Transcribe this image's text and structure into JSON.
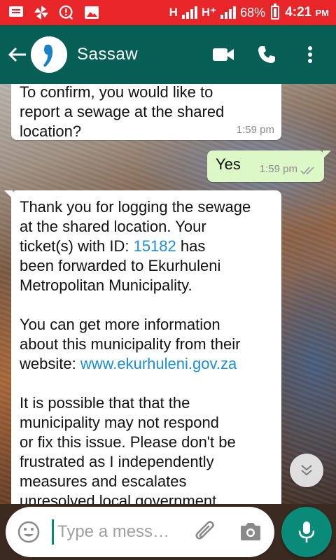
{
  "status_bar": {
    "network_1": "H",
    "network_2": "H⁺",
    "battery": "68%",
    "time": "4:21",
    "meridiem": "PM"
  },
  "app_bar": {
    "contact_name": "Sassaw",
    "icons": [
      "back-arrow-icon",
      "video-call-icon",
      "phone-icon",
      "more-options-icon"
    ],
    "color": "#075e54"
  },
  "messages": [
    {
      "direction": "incoming",
      "text": "To confirm, you would like to\nreport a sewage at the shared\nlocation?",
      "time": "1:59 pm"
    },
    {
      "direction": "outgoing",
      "text": "Yes",
      "time": "1:59 pm",
      "status": "read"
    },
    {
      "direction": "incoming",
      "parts": {
        "p1_before": "Thank you for logging the sewage\nat the shared location. Your\nticket(s) with ID: ",
        "ticket_id": "15182",
        "p1_after": " has\nbeen forwarded to Ekurhuleni\nMetropolitan Municipality.",
        "p2_before": "You can get more information\nabout this municipality from their\nwebsite: ",
        "website": "www.ekurhuleni.gov.za",
        "p3": "It is possible that that the\nmunicipality may not respond\nor fix this issue. Please don't be\nfrustrated as I independently\nmeasures and escalates\nunresolved local government"
      }
    }
  ],
  "input": {
    "placeholder": "Type a mess…"
  },
  "colors": {
    "status_bar": "#e8262a",
    "outgoing_bubble": "#dcf8c6",
    "link": "#1a8fd8",
    "accent": "#0a8a78"
  }
}
